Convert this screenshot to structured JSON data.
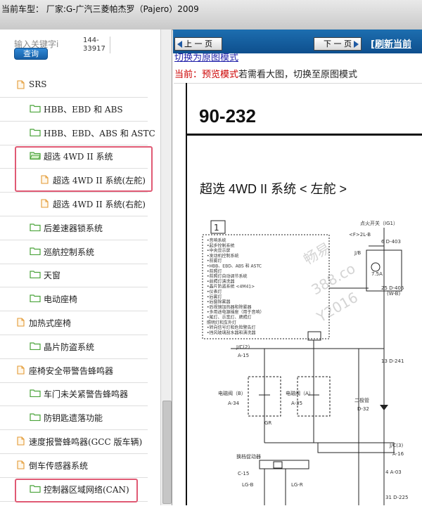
{
  "header": {
    "current_car": "当前车型：  厂家:G-广汽三菱帕杰罗（Pajero）2009"
  },
  "search": {
    "label": "输入关键字i",
    "button": "查询",
    "code_lines": [
      "144-",
      "33917"
    ]
  },
  "tree": {
    "items": [
      {
        "label": "SRS",
        "type": "doc"
      },
      {
        "label": "HBB、EBD 和 ABS",
        "type": "folder"
      },
      {
        "label": "HBB、EBD、ABS 和 ASTC",
        "type": "folder"
      },
      {
        "label": "超选 4WD II 系统",
        "type": "folder-open"
      },
      {
        "label": "超选 4WD II 系统(左舵)",
        "type": "doc"
      },
      {
        "label": "超选 4WD II 系统(右舵)",
        "type": "doc"
      },
      {
        "label": "后差速器锁系统",
        "type": "folder"
      },
      {
        "label": "巡航控制系统",
        "type": "folder"
      },
      {
        "label": "天窗",
        "type": "folder"
      },
      {
        "label": "电动座椅",
        "type": "folder"
      },
      {
        "label": "加热式座椅",
        "type": "doc"
      },
      {
        "label": "晶片防盗系统",
        "type": "folder"
      },
      {
        "label": "座椅安全带警告蜂鸣器",
        "type": "doc"
      },
      {
        "label": "车门未关紧警告蜂鸣器",
        "type": "folder"
      },
      {
        "label": "防钥匙遗落功能",
        "type": "folder"
      },
      {
        "label": "速度报警蜂鸣器(GCC 版车辆)",
        "type": "doc"
      },
      {
        "label": "倒车传感器系统",
        "type": "doc"
      },
      {
        "label": "控制器区域网络(CAN)",
        "type": "folder"
      }
    ]
  },
  "nav": {
    "prev": "上 一 页",
    "next": "下 一 页",
    "refresh": "[刷新当前"
  },
  "mode": {
    "switch_link": "切换为原图模式",
    "current_prefix": "当前：",
    "current_mode": "预览模式",
    "hint": "若需看大图，切换至原图模式"
  },
  "document": {
    "page_number": "90-232",
    "title": "超选 4WD II 系统 < 左舵 >",
    "box_label": "1",
    "watermark": [
      "畅易",
      "388.co",
      "Y2016"
    ],
    "diagram_labels": {
      "ignition": "点火开关（IG1）",
      "f2": "<F>2L-B",
      "d403": "6 D-403",
      "jb": "J/B",
      "fuse": "7.5A",
      "wb": "(W-B)",
      "d405": "25 D-405",
      "jc": "J/C(2)",
      "a15": "A-15",
      "d241": "13 D-241",
      "valve_b": "电磁阀（B）",
      "valve_a": "电磁阀（A）",
      "a34": "A-34",
      "a35": "A-35",
      "diode": "二极管",
      "d32": "D-32",
      "gr": "GR",
      "jc3": "J/C(3)",
      "a16": "A-16",
      "actuator": "换档促动器",
      "c15": "C-15",
      "a03": "4 A-03",
      "d225": "31 D-225",
      "lgb": "LG-B",
      "lgr": "LG-R"
    },
    "legend_lines": [
      "•音响系统",
      "•起步控制系统",
      "•中央显示屏",
      "•发动机控制系统",
      "•前雾灯",
      "•HBB、EBD、ABS 和 ASTC",
      "•前照灯",
      "•前照灯自动调节系统",
      "•前照灯清洗器",
      "•晶片防盗系统 <4M41>",
      "•仪表灯",
      "•后雾灯",
      "•后窗除雾器",
      "•后视镜加热器和除雾器",
      "•多用途电源插座（用于音响）",
      "•尾灯、示宽灯、牌照灯",
      "  照明灯和车外灯",
      "•转向信号灯和危险警告灯",
      "•挡风玻璃刮水器和清洗器"
    ]
  }
}
